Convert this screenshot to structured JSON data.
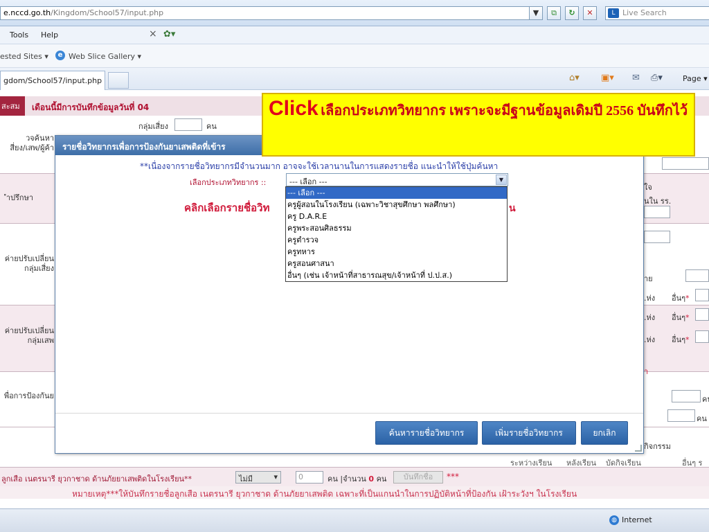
{
  "browser": {
    "url_host": "e.nccd.go.th",
    "url_path": "/Kingdom/School57/input.php",
    "search_placeholder": "Live Search",
    "menu": [
      "Tools",
      "Help"
    ],
    "favorites": [
      "ested Sites ▾",
      "Web Slice Gallery ▾"
    ],
    "tab_title": "gdom/School57/input.php",
    "page_menu": "Page ▾",
    "status_zone": "Internet"
  },
  "page": {
    "side_tab": "สะสม",
    "header_title": "เดือนนี้มีการบันทึกข้อมูลวันที่ 04",
    "top_group_label": "กลุ่มเสี่ยง",
    "top_group_unit": "คน",
    "left_labels": [
      "วจค้นหา\nสี่ยง/เสพ/ผู้ค้า",
      "ำปรึกษา",
      "ค่ายปรับเปลี่ยน\nกลุ่มเสี่ยง",
      "ค่ายปรับเปลี่ยน\nกลุ่มเสพ",
      "พื่อการป้องกันย"
    ],
    "right_fragments": {
      "r1": "ใจ",
      "r2": "นใน รร.",
      "r3": "าย",
      "r4a": ".ห่ง",
      "r4b": "อื่นๆ",
      "r5a": ".ห่ง",
      "r5b": "อื่นๆ",
      "r6a": ".ห่ง",
      "r6b": "อื่นๆ",
      "r7": "า",
      "r8": "คน",
      "r9": "คน",
      "r10": "กิจกรรม",
      "r11a": "ระหว่างเรียน",
      "r11b": "หลังเรียน",
      "r11c": "บัดกิจเรียน",
      "r11d": "อื่นๆ ร"
    },
    "bottom_label": "ลูกเสือ เนตรนารี ยุวกาชาด ด้านภัยยาเสพติดในโรงเรียน**",
    "bottom_select": "ไม่มี",
    "bottom_num": "0",
    "bottom_unit_a": "คน |จำนวน",
    "bottom_count": "0",
    "bottom_unit_b": "คน",
    "bottom_save": "บันทึกชื่อ",
    "bottom_stars": "***",
    "note": "หมายเหตุ***ให้บันทึกรายชื่อลูกเสือ เนตรนารี ยุวกาชาด ด้านภัยยาเสพติด เฉพาะที่เป็นแกนนำในการปฏิบัติหน้าที่ป้องกัน เฝ้าระวังฯ ในโรงเรียน"
  },
  "modal": {
    "title": "รายชื่อวิทยากรเพื่อการป้องกันยาเสพติดที่เข้าร",
    "note": "**เนื่องจากรายชื่อวิทยากรมีจำนวนมาก อาจจะใช้เวลานานในการแสดงรายชื่อ แนะนำให้ใช้ปุ่มค้นหา",
    "type_label": "เลือกประเภทวิทยากร ::",
    "select_value": "--- เลือก ---",
    "click_hint": "คลิกเลือกรายชื่อวิท",
    "click_hint_tail": "น",
    "buttons": {
      "search": "ค้นหารายชื่อวิทยากร",
      "add": "เพิ่มรายชื่อวิทยากร",
      "cancel": "ยกเลิก"
    },
    "options": [
      "--- เลือก ---",
      "ครูผู้สอนในโรงเรียน (เฉพาะวิชาสุขศึกษา พลศึกษา)",
      "ครู D.A.R.E",
      "ครูพระสอนศิลธรรม",
      "ครูตำรวจ",
      "ครูทหาร",
      "ครูสอนศาสนา",
      "อื่นๆ (เช่น เจ้าหน้าที่สาธารณสุข/เจ้าหน้าที่ ป.ป.ส.)"
    ]
  },
  "callout": {
    "click": "Click",
    "text": "เลือกประเภทวิทยากร เพราะจะมีฐานข้อมูลเดิมปี 2556 บันทึกไว้"
  },
  "colors": {
    "accent_red": "#b01030",
    "modal_title_bg": "#3d6ea8",
    "selected_option": "#3169c6",
    "callout_bg": "#ffff00"
  }
}
